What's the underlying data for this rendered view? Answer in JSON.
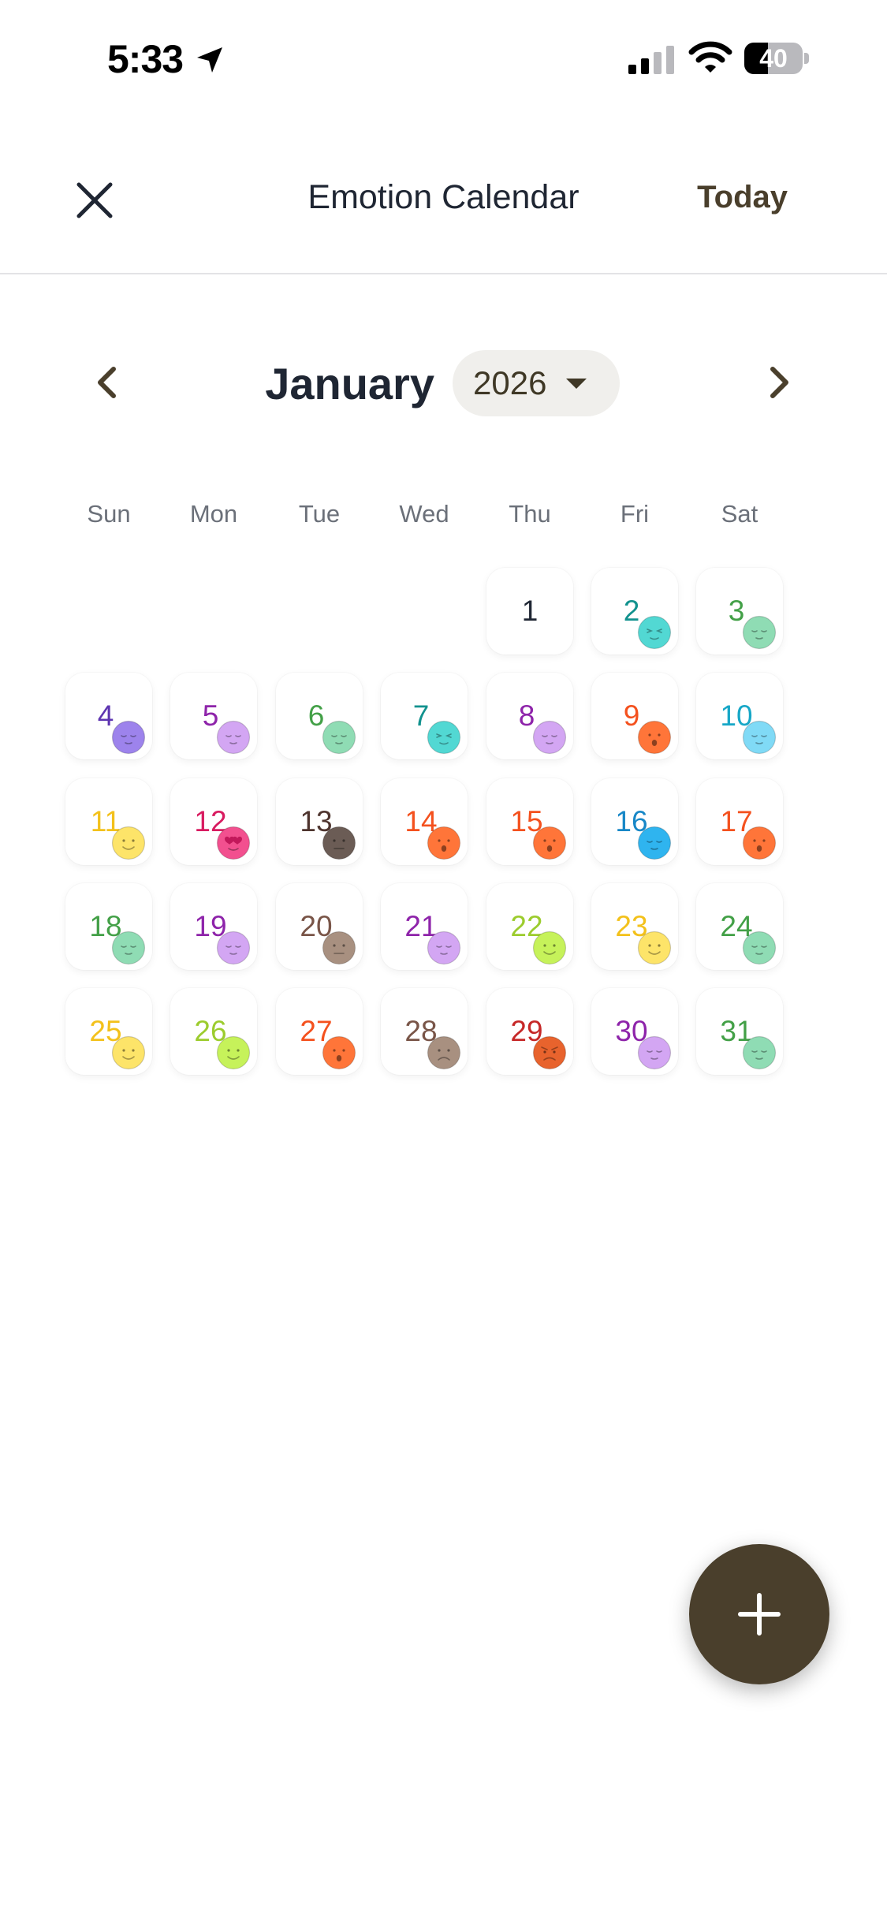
{
  "status_bar": {
    "time": "5:33",
    "battery": "40",
    "battery_level": 0.4
  },
  "header": {
    "title": "Emotion Calendar",
    "today_label": "Today"
  },
  "month_nav": {
    "month": "January",
    "year": "2026"
  },
  "weekdays": [
    "Sun",
    "Mon",
    "Tue",
    "Wed",
    "Thu",
    "Fri",
    "Sat"
  ],
  "colors": {
    "brand": "#4a3f2c",
    "title_text": "#1f2633",
    "weekday_text": "#6b7079"
  },
  "days": [
    {
      "day": "1",
      "weekday": "Thu",
      "text_color": "#1f2633",
      "face": null
    },
    {
      "day": "2",
      "weekday": "Fri",
      "text_color": "#12928e",
      "face": {
        "color": "#52d8d3",
        "expr": "squint"
      }
    },
    {
      "day": "3",
      "weekday": "Sat",
      "text_color": "#43a047",
      "face": {
        "color": "#8fdcb4",
        "expr": "calm"
      }
    },
    {
      "day": "4",
      "weekday": "Sun",
      "text_color": "#5e35b1",
      "face": {
        "color": "#9d83ec",
        "expr": "calm"
      }
    },
    {
      "day": "5",
      "weekday": "Mon",
      "text_color": "#8e24aa",
      "face": {
        "color": "#d3a6f3",
        "expr": "calm"
      }
    },
    {
      "day": "6",
      "weekday": "Tue",
      "text_color": "#43a047",
      "face": {
        "color": "#8fdcb4",
        "expr": "calm"
      }
    },
    {
      "day": "7",
      "weekday": "Wed",
      "text_color": "#12928e",
      "face": {
        "color": "#52d8d3",
        "expr": "squint"
      }
    },
    {
      "day": "8",
      "weekday": "Thu",
      "text_color": "#8e24aa",
      "face": {
        "color": "#d3a6f3",
        "expr": "calm"
      }
    },
    {
      "day": "9",
      "weekday": "Fri",
      "text_color": "#f4511e",
      "face": {
        "color": "#ff7539",
        "expr": "surprise"
      }
    },
    {
      "day": "10",
      "weekday": "Sat",
      "text_color": "#17a7c7",
      "face": {
        "color": "#80daf6",
        "expr": "calm"
      }
    },
    {
      "day": "11",
      "weekday": "Sun",
      "text_color": "#f3c11b",
      "face": {
        "color": "#fde469",
        "expr": "smile"
      }
    },
    {
      "day": "12",
      "weekday": "Mon",
      "text_color": "#d81b60",
      "face": {
        "color": "#f2508f",
        "expr": "love"
      }
    },
    {
      "day": "13",
      "weekday": "Tue",
      "text_color": "#4e342e",
      "face": {
        "color": "#6b5c55",
        "expr": "meh"
      }
    },
    {
      "day": "14",
      "weekday": "Wed",
      "text_color": "#f4511e",
      "face": {
        "color": "#ff7539",
        "expr": "surprise"
      }
    },
    {
      "day": "15",
      "weekday": "Thu",
      "text_color": "#f4511e",
      "face": {
        "color": "#ff7539",
        "expr": "surprise"
      }
    },
    {
      "day": "16",
      "weekday": "Fri",
      "text_color": "#1787c7",
      "face": {
        "color": "#2fb4ef",
        "expr": "calm"
      }
    },
    {
      "day": "17",
      "weekday": "Sat",
      "text_color": "#f4511e",
      "face": {
        "color": "#ff7539",
        "expr": "surprise"
      }
    },
    {
      "day": "18",
      "weekday": "Sun",
      "text_color": "#43a047",
      "face": {
        "color": "#8fdcb4",
        "expr": "calm"
      }
    },
    {
      "day": "19",
      "weekday": "Mon",
      "text_color": "#8e24aa",
      "face": {
        "color": "#d3a6f3",
        "expr": "calm"
      }
    },
    {
      "day": "20",
      "weekday": "Tue",
      "text_color": "#795548",
      "face": {
        "color": "#a89080",
        "expr": "meh"
      }
    },
    {
      "day": "21",
      "weekday": "Wed",
      "text_color": "#8e24aa",
      "face": {
        "color": "#d3a6f3",
        "expr": "calm"
      }
    },
    {
      "day": "22",
      "weekday": "Thu",
      "text_color": "#9ccc2e",
      "face": {
        "color": "#c6f25a",
        "expr": "smile"
      }
    },
    {
      "day": "23",
      "weekday": "Fri",
      "text_color": "#f3c11b",
      "face": {
        "color": "#fde469",
        "expr": "smile"
      }
    },
    {
      "day": "24",
      "weekday": "Sat",
      "text_color": "#43a047",
      "face": {
        "color": "#8fdcb4",
        "expr": "calm"
      }
    },
    {
      "day": "25",
      "weekday": "Sun",
      "text_color": "#f3c11b",
      "face": {
        "color": "#fde469",
        "expr": "smile"
      }
    },
    {
      "day": "26",
      "weekday": "Mon",
      "text_color": "#9ccc2e",
      "face": {
        "color": "#c6f25a",
        "expr": "smile"
      }
    },
    {
      "day": "27",
      "weekday": "Tue",
      "text_color": "#f4511e",
      "face": {
        "color": "#ff7539",
        "expr": "surprise"
      }
    },
    {
      "day": "28",
      "weekday": "Wed",
      "text_color": "#795548",
      "face": {
        "color": "#a89080",
        "expr": "frown"
      }
    },
    {
      "day": "29",
      "weekday": "Thu",
      "text_color": "#c62828",
      "face": {
        "color": "#e8632d",
        "expr": "angry"
      }
    },
    {
      "day": "30",
      "weekday": "Fri",
      "text_color": "#8e24aa",
      "face": {
        "color": "#d3a6f3",
        "expr": "calm"
      }
    },
    {
      "day": "31",
      "weekday": "Sat",
      "text_color": "#43a047",
      "face": {
        "color": "#8fdcb4",
        "expr": "calm"
      }
    }
  ],
  "fab": {
    "icon": "plus-icon"
  }
}
